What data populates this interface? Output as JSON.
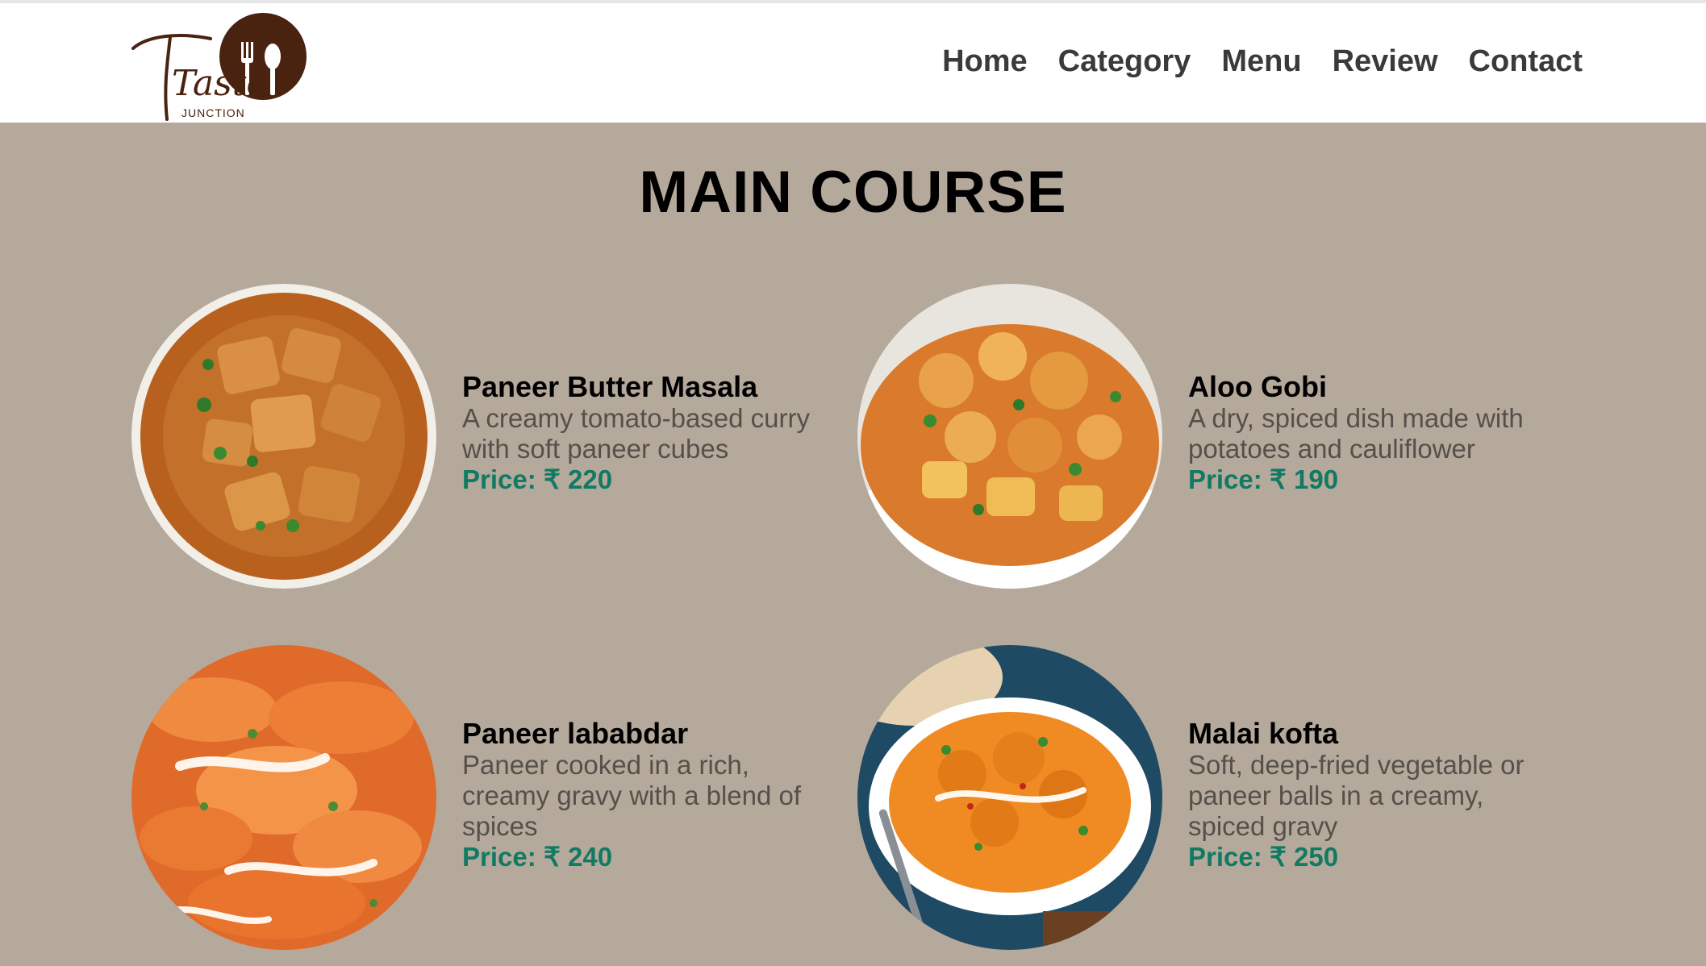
{
  "brand": {
    "logo_script": "Taste",
    "logo_sub": "JUNCTION"
  },
  "nav": {
    "items": [
      {
        "label": "Home"
      },
      {
        "label": "Category"
      },
      {
        "label": "Menu"
      },
      {
        "label": "Review"
      },
      {
        "label": "Contact"
      }
    ]
  },
  "section": {
    "title": "MAIN COURSE"
  },
  "dishes": [
    {
      "name": "Paneer Butter Masala",
      "description": "A creamy tomato-based curry with soft paneer cubes",
      "price": "Price: ₹ 220",
      "image": "paneer-butter-masala-photo"
    },
    {
      "name": "Aloo Gobi",
      "description": "A dry, spiced dish made with potatoes and cauliflower",
      "price": "Price: ₹ 190",
      "image": "aloo-gobi-photo"
    },
    {
      "name": "Paneer lababdar",
      "description": "Paneer cooked in a rich, creamy gravy with a blend of spices",
      "price": "Price: ₹ 240",
      "image": "paneer-lababdar-photo"
    },
    {
      "name": "Malai kofta",
      "description": "Soft, deep-fried vegetable or paneer balls in a creamy, spiced gravy",
      "price": "Price: ₹ 250",
      "image": "malai-kofta-photo"
    }
  ],
  "colors": {
    "page_background": "#b5a99c",
    "navbar_background": "#ffffff",
    "nav_text": "#3a3a3a",
    "price_text": "#117a62",
    "logo_brown": "#4a2210"
  }
}
